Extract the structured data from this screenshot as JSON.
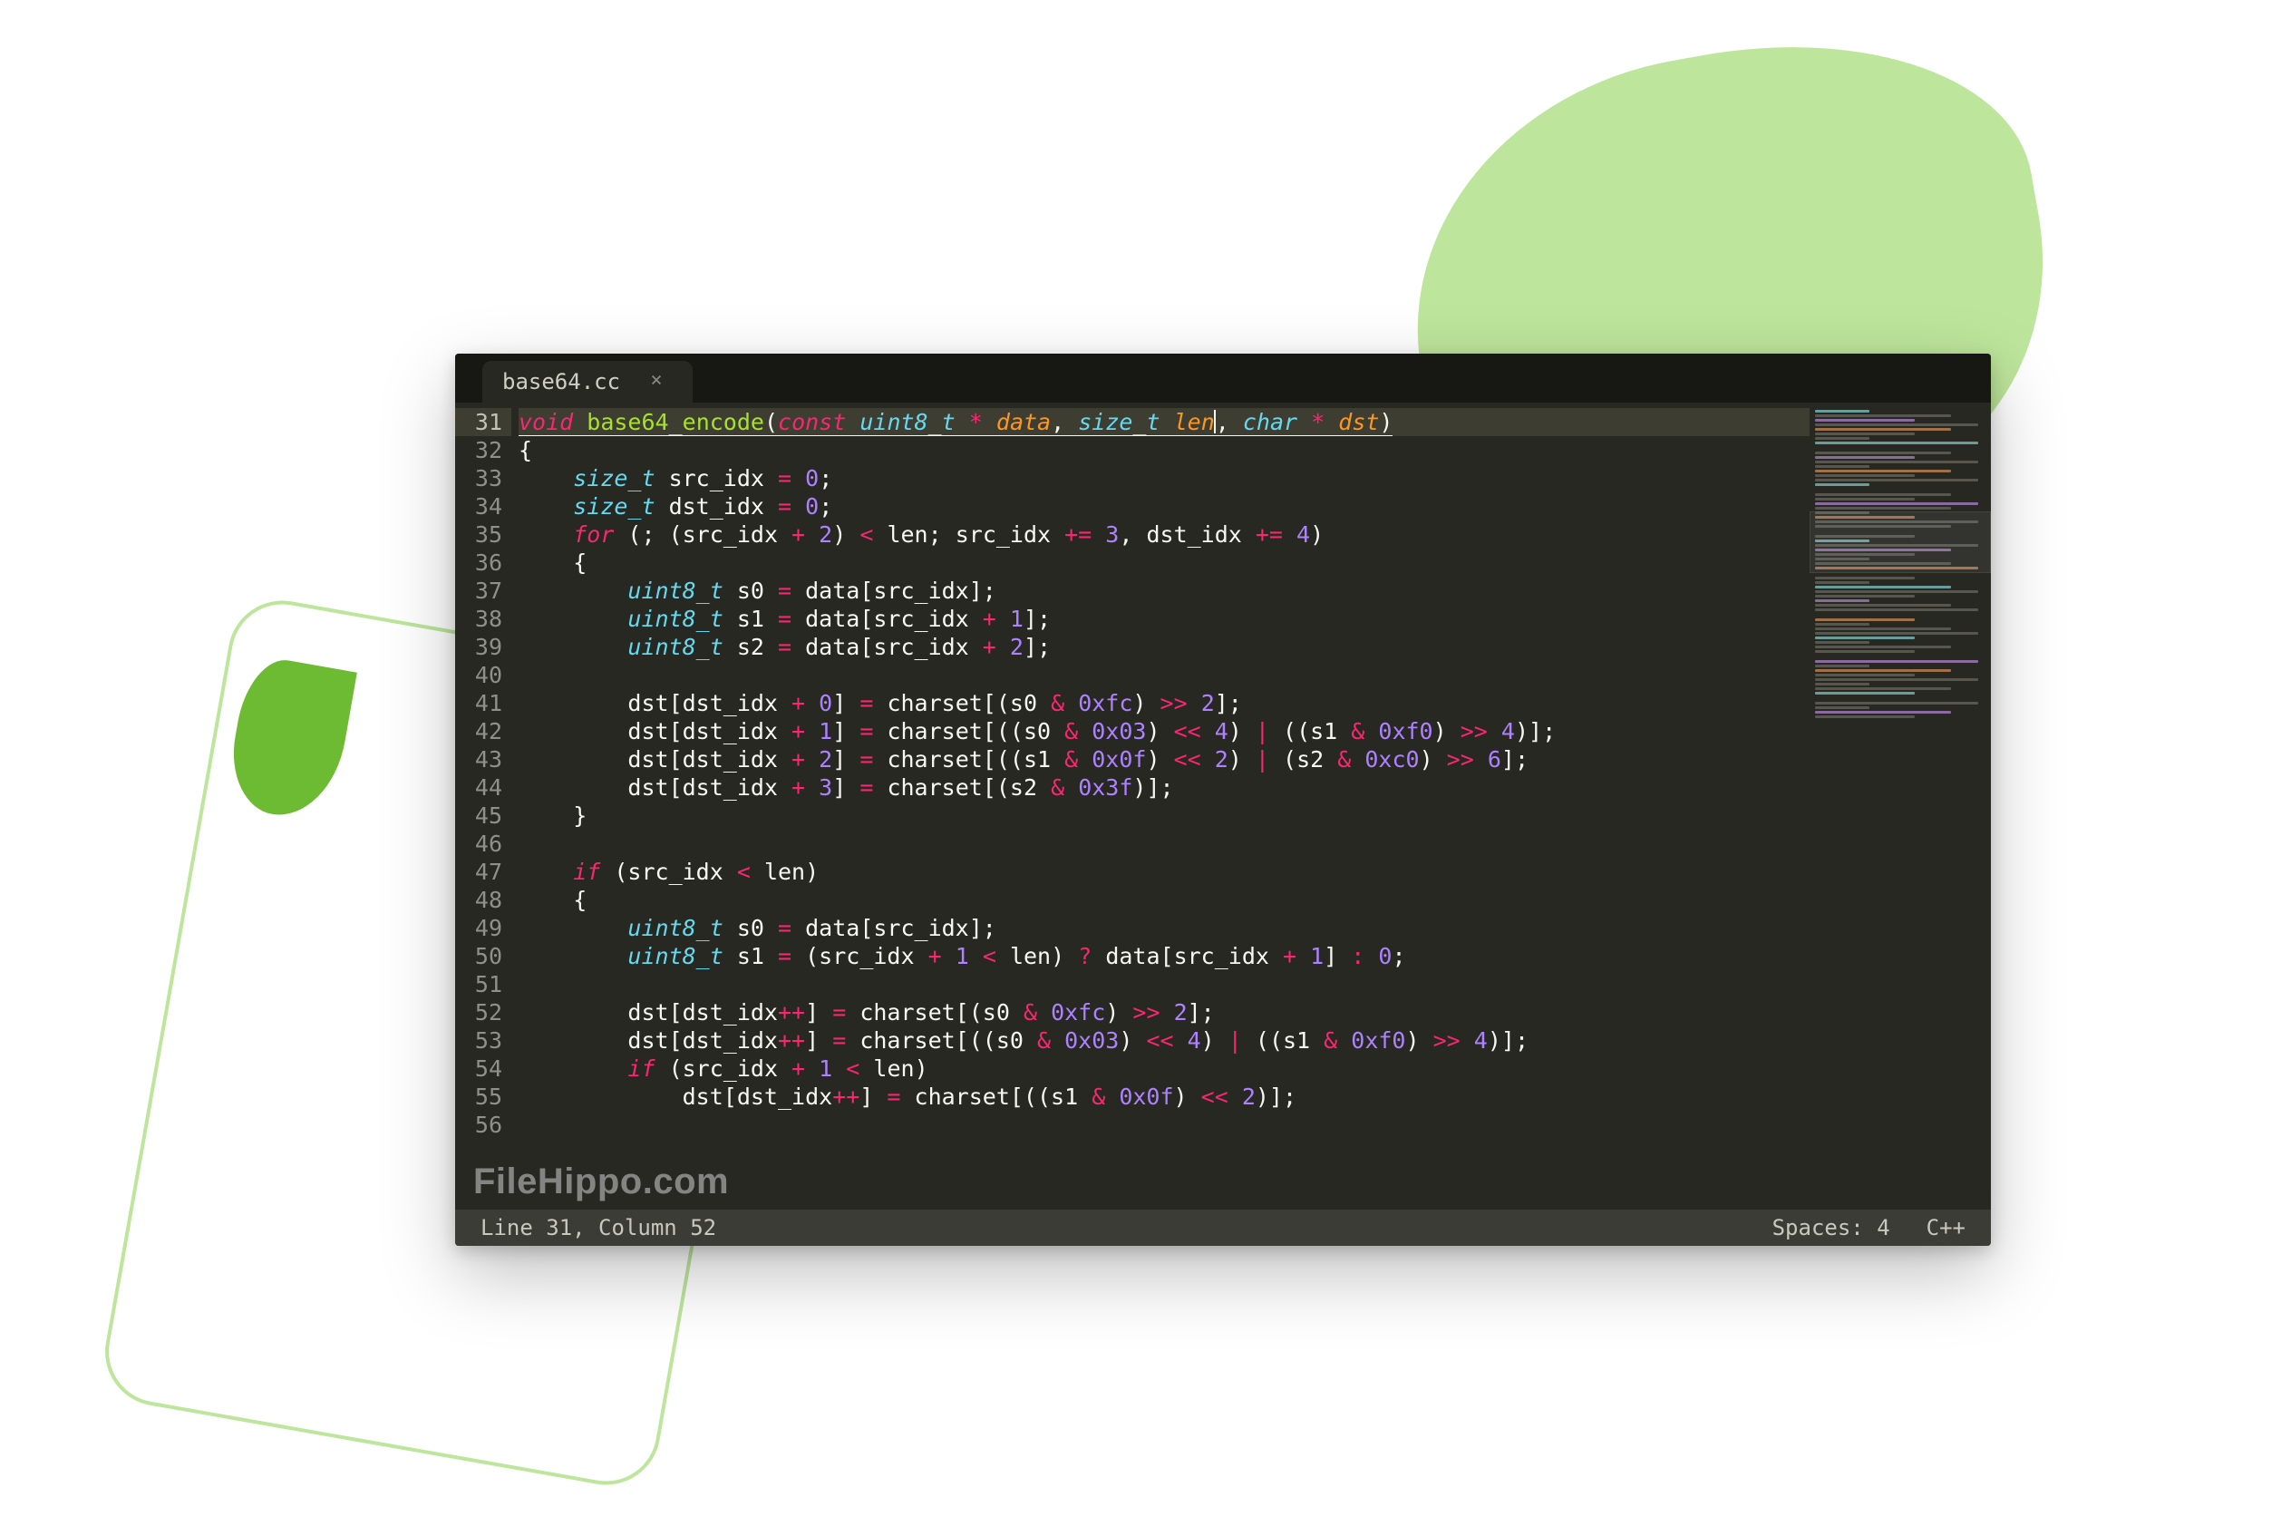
{
  "tab": {
    "title": "base64.cc",
    "close": "×"
  },
  "statusbar": {
    "position": "Line 31, Column 52",
    "spaces": "Spaces: 4",
    "lang": "C++"
  },
  "watermark": "FileHippo.com",
  "gutter": {
    "start": 31,
    "end": 56,
    "current": 31
  },
  "code": [
    {
      "n": 31,
      "current": true,
      "tokens": [
        [
          "kw",
          "void"
        ],
        [
          "pn",
          " "
        ],
        [
          "fn",
          "base64_encode"
        ],
        [
          "pn",
          "("
        ],
        [
          "kw",
          "const"
        ],
        [
          "pn",
          " "
        ],
        [
          "type",
          "uint8_t"
        ],
        [
          "pn",
          " "
        ],
        [
          "op",
          "*"
        ],
        [
          "pn",
          " "
        ],
        [
          "param",
          "data"
        ],
        [
          "pn",
          ", "
        ],
        [
          "type",
          "size_t"
        ],
        [
          "pn",
          " "
        ],
        [
          "param",
          "len"
        ],
        [
          "cursor",
          ""
        ],
        [
          "pn",
          ", "
        ],
        [
          "type",
          "char"
        ],
        [
          "pn",
          " "
        ],
        [
          "op",
          "*"
        ],
        [
          "pn",
          " "
        ],
        [
          "param",
          "dst"
        ],
        [
          "pn",
          ")"
        ]
      ],
      "underline_tail": true
    },
    {
      "n": 32,
      "tokens": [
        [
          "pn",
          "{"
        ]
      ]
    },
    {
      "n": 33,
      "tokens": [
        [
          "pn",
          "    "
        ],
        [
          "type",
          "size_t"
        ],
        [
          "pn",
          " src_idx "
        ],
        [
          "op",
          "="
        ],
        [
          "pn",
          " "
        ],
        [
          "num",
          "0"
        ],
        [
          "pn",
          ";"
        ]
      ]
    },
    {
      "n": 34,
      "tokens": [
        [
          "pn",
          "    "
        ],
        [
          "type",
          "size_t"
        ],
        [
          "pn",
          " dst_idx "
        ],
        [
          "op",
          "="
        ],
        [
          "pn",
          " "
        ],
        [
          "num",
          "0"
        ],
        [
          "pn",
          ";"
        ]
      ]
    },
    {
      "n": 35,
      "tokens": [
        [
          "pn",
          "    "
        ],
        [
          "kw",
          "for"
        ],
        [
          "pn",
          " (; (src_idx "
        ],
        [
          "op",
          "+"
        ],
        [
          "pn",
          " "
        ],
        [
          "num",
          "2"
        ],
        [
          "pn",
          ") "
        ],
        [
          "op",
          "<"
        ],
        [
          "pn",
          " len; src_idx "
        ],
        [
          "op",
          "+="
        ],
        [
          "pn",
          " "
        ],
        [
          "num",
          "3"
        ],
        [
          "pn",
          ", dst_idx "
        ],
        [
          "op",
          "+="
        ],
        [
          "pn",
          " "
        ],
        [
          "num",
          "4"
        ],
        [
          "pn",
          ")"
        ]
      ]
    },
    {
      "n": 36,
      "tokens": [
        [
          "pn",
          "    {"
        ]
      ]
    },
    {
      "n": 37,
      "tokens": [
        [
          "pn",
          "        "
        ],
        [
          "type",
          "uint8_t"
        ],
        [
          "pn",
          " s0 "
        ],
        [
          "op",
          "="
        ],
        [
          "pn",
          " data[src_idx];"
        ]
      ]
    },
    {
      "n": 38,
      "tokens": [
        [
          "pn",
          "        "
        ],
        [
          "type",
          "uint8_t"
        ],
        [
          "pn",
          " s1 "
        ],
        [
          "op",
          "="
        ],
        [
          "pn",
          " data[src_idx "
        ],
        [
          "op",
          "+"
        ],
        [
          "pn",
          " "
        ],
        [
          "num",
          "1"
        ],
        [
          "pn",
          "];"
        ]
      ]
    },
    {
      "n": 39,
      "tokens": [
        [
          "pn",
          "        "
        ],
        [
          "type",
          "uint8_t"
        ],
        [
          "pn",
          " s2 "
        ],
        [
          "op",
          "="
        ],
        [
          "pn",
          " data[src_idx "
        ],
        [
          "op",
          "+"
        ],
        [
          "pn",
          " "
        ],
        [
          "num",
          "2"
        ],
        [
          "pn",
          "];"
        ]
      ]
    },
    {
      "n": 40,
      "tokens": [
        [
          "pn",
          ""
        ]
      ]
    },
    {
      "n": 41,
      "tokens": [
        [
          "pn",
          "        dst[dst_idx "
        ],
        [
          "op",
          "+"
        ],
        [
          "pn",
          " "
        ],
        [
          "num",
          "0"
        ],
        [
          "pn",
          "] "
        ],
        [
          "op",
          "="
        ],
        [
          "pn",
          " charset[(s0 "
        ],
        [
          "op",
          "&"
        ],
        [
          "pn",
          " "
        ],
        [
          "num",
          "0xfc"
        ],
        [
          "pn",
          ") "
        ],
        [
          "op",
          ">>"
        ],
        [
          "pn",
          " "
        ],
        [
          "num",
          "2"
        ],
        [
          "pn",
          "];"
        ]
      ]
    },
    {
      "n": 42,
      "tokens": [
        [
          "pn",
          "        dst[dst_idx "
        ],
        [
          "op",
          "+"
        ],
        [
          "pn",
          " "
        ],
        [
          "num",
          "1"
        ],
        [
          "pn",
          "] "
        ],
        [
          "op",
          "="
        ],
        [
          "pn",
          " charset[((s0 "
        ],
        [
          "op",
          "&"
        ],
        [
          "pn",
          " "
        ],
        [
          "num",
          "0x03"
        ],
        [
          "pn",
          ") "
        ],
        [
          "op",
          "<<"
        ],
        [
          "pn",
          " "
        ],
        [
          "num",
          "4"
        ],
        [
          "pn",
          ") "
        ],
        [
          "op",
          "|"
        ],
        [
          "pn",
          " ((s1 "
        ],
        [
          "op",
          "&"
        ],
        [
          "pn",
          " "
        ],
        [
          "num",
          "0xf0"
        ],
        [
          "pn",
          ") "
        ],
        [
          "op",
          ">>"
        ],
        [
          "pn",
          " "
        ],
        [
          "num",
          "4"
        ],
        [
          "pn",
          ")];"
        ]
      ]
    },
    {
      "n": 43,
      "tokens": [
        [
          "pn",
          "        dst[dst_idx "
        ],
        [
          "op",
          "+"
        ],
        [
          "pn",
          " "
        ],
        [
          "num",
          "2"
        ],
        [
          "pn",
          "] "
        ],
        [
          "op",
          "="
        ],
        [
          "pn",
          " charset[((s1 "
        ],
        [
          "op",
          "&"
        ],
        [
          "pn",
          " "
        ],
        [
          "num",
          "0x0f"
        ],
        [
          "pn",
          ") "
        ],
        [
          "op",
          "<<"
        ],
        [
          "pn",
          " "
        ],
        [
          "num",
          "2"
        ],
        [
          "pn",
          ") "
        ],
        [
          "op",
          "|"
        ],
        [
          "pn",
          " (s2 "
        ],
        [
          "op",
          "&"
        ],
        [
          "pn",
          " "
        ],
        [
          "num",
          "0xc0"
        ],
        [
          "pn",
          ") "
        ],
        [
          "op",
          ">>"
        ],
        [
          "pn",
          " "
        ],
        [
          "num",
          "6"
        ],
        [
          "pn",
          "];"
        ]
      ]
    },
    {
      "n": 44,
      "tokens": [
        [
          "pn",
          "        dst[dst_idx "
        ],
        [
          "op",
          "+"
        ],
        [
          "pn",
          " "
        ],
        [
          "num",
          "3"
        ],
        [
          "pn",
          "] "
        ],
        [
          "op",
          "="
        ],
        [
          "pn",
          " charset[(s2 "
        ],
        [
          "op",
          "&"
        ],
        [
          "pn",
          " "
        ],
        [
          "num",
          "0x3f"
        ],
        [
          "pn",
          ")];"
        ]
      ]
    },
    {
      "n": 45,
      "tokens": [
        [
          "pn",
          "    }"
        ]
      ]
    },
    {
      "n": 46,
      "tokens": [
        [
          "pn",
          ""
        ]
      ]
    },
    {
      "n": 47,
      "tokens": [
        [
          "pn",
          "    "
        ],
        [
          "kw",
          "if"
        ],
        [
          "pn",
          " (src_idx "
        ],
        [
          "op",
          "<"
        ],
        [
          "pn",
          " len)"
        ]
      ]
    },
    {
      "n": 48,
      "tokens": [
        [
          "pn",
          "    {"
        ]
      ]
    },
    {
      "n": 49,
      "tokens": [
        [
          "pn",
          "        "
        ],
        [
          "type",
          "uint8_t"
        ],
        [
          "pn",
          " s0 "
        ],
        [
          "op",
          "="
        ],
        [
          "pn",
          " data[src_idx];"
        ]
      ]
    },
    {
      "n": 50,
      "tokens": [
        [
          "pn",
          "        "
        ],
        [
          "type",
          "uint8_t"
        ],
        [
          "pn",
          " s1 "
        ],
        [
          "op",
          "="
        ],
        [
          "pn",
          " (src_idx "
        ],
        [
          "op",
          "+"
        ],
        [
          "pn",
          " "
        ],
        [
          "num",
          "1"
        ],
        [
          "pn",
          " "
        ],
        [
          "op",
          "<"
        ],
        [
          "pn",
          " len) "
        ],
        [
          "op",
          "?"
        ],
        [
          "pn",
          " data[src_idx "
        ],
        [
          "op",
          "+"
        ],
        [
          "pn",
          " "
        ],
        [
          "num",
          "1"
        ],
        [
          "pn",
          "] "
        ],
        [
          "op",
          ":"
        ],
        [
          "pn",
          " "
        ],
        [
          "num",
          "0"
        ],
        [
          "pn",
          ";"
        ]
      ]
    },
    {
      "n": 51,
      "tokens": [
        [
          "pn",
          ""
        ]
      ]
    },
    {
      "n": 52,
      "tokens": [
        [
          "pn",
          "        dst[dst_idx"
        ],
        [
          "op",
          "++"
        ],
        [
          "pn",
          "] "
        ],
        [
          "op",
          "="
        ],
        [
          "pn",
          " charset[(s0 "
        ],
        [
          "op",
          "&"
        ],
        [
          "pn",
          " "
        ],
        [
          "num",
          "0xfc"
        ],
        [
          "pn",
          ") "
        ],
        [
          "op",
          ">>"
        ],
        [
          "pn",
          " "
        ],
        [
          "num",
          "2"
        ],
        [
          "pn",
          "];"
        ]
      ]
    },
    {
      "n": 53,
      "tokens": [
        [
          "pn",
          "        dst[dst_idx"
        ],
        [
          "op",
          "++"
        ],
        [
          "pn",
          "] "
        ],
        [
          "op",
          "="
        ],
        [
          "pn",
          " charset[((s0 "
        ],
        [
          "op",
          "&"
        ],
        [
          "pn",
          " "
        ],
        [
          "num",
          "0x03"
        ],
        [
          "pn",
          ") "
        ],
        [
          "op",
          "<<"
        ],
        [
          "pn",
          " "
        ],
        [
          "num",
          "4"
        ],
        [
          "pn",
          ") "
        ],
        [
          "op",
          "|"
        ],
        [
          "pn",
          " ((s1 "
        ],
        [
          "op",
          "&"
        ],
        [
          "pn",
          " "
        ],
        [
          "num",
          "0xf0"
        ],
        [
          "pn",
          ") "
        ],
        [
          "op",
          ">>"
        ],
        [
          "pn",
          " "
        ],
        [
          "num",
          "4"
        ],
        [
          "pn",
          ")];"
        ]
      ]
    },
    {
      "n": 54,
      "tokens": [
        [
          "pn",
          "        "
        ],
        [
          "kw",
          "if"
        ],
        [
          "pn",
          " (src_idx "
        ],
        [
          "op",
          "+"
        ],
        [
          "pn",
          " "
        ],
        [
          "num",
          "1"
        ],
        [
          "pn",
          " "
        ],
        [
          "op",
          "<"
        ],
        [
          "pn",
          " len)"
        ]
      ]
    },
    {
      "n": 55,
      "tokens": [
        [
          "pn",
          "            dst[dst_idx"
        ],
        [
          "op",
          "++"
        ],
        [
          "pn",
          "] "
        ],
        [
          "op",
          "="
        ],
        [
          "pn",
          " charset[((s1 "
        ],
        [
          "op",
          "&"
        ],
        [
          "pn",
          " "
        ],
        [
          "num",
          "0x0f"
        ],
        [
          "pn",
          ") "
        ],
        [
          "op",
          "<<"
        ],
        [
          "pn",
          " "
        ],
        [
          "num",
          "2"
        ],
        [
          "pn",
          ")];"
        ]
      ]
    },
    {
      "n": 56,
      "tokens": [
        [
          "pn",
          ""
        ]
      ]
    }
  ]
}
